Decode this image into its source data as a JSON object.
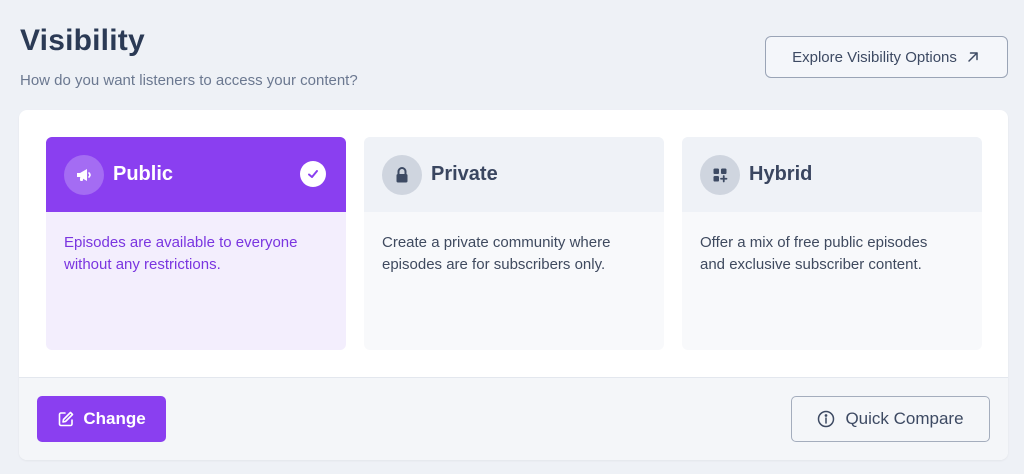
{
  "header": {
    "title": "Visibility",
    "subtitle": "How do you want listeners to access your content?",
    "explore_label": "Explore Visibility Options"
  },
  "options": [
    {
      "title": "Public",
      "description_lines": [
        "Episodes are available to everyone",
        "without any restrictions."
      ],
      "icon": "megaphone-icon",
      "selected": true
    },
    {
      "title": "Private",
      "description_lines": [
        "Create a private community where",
        "episodes are for subscribers only."
      ],
      "icon": "lock-icon",
      "selected": false
    },
    {
      "title": "Hybrid",
      "description_lines": [
        "Offer a mix of free public episodes",
        "and exclusive subscriber content."
      ],
      "icon": "shapes-icon",
      "selected": false
    }
  ],
  "footer": {
    "change_label": "Change",
    "compare_label": "Quick Compare"
  },
  "colors": {
    "accent": "#8a3ff0",
    "page_bg": "#eef1f6"
  }
}
